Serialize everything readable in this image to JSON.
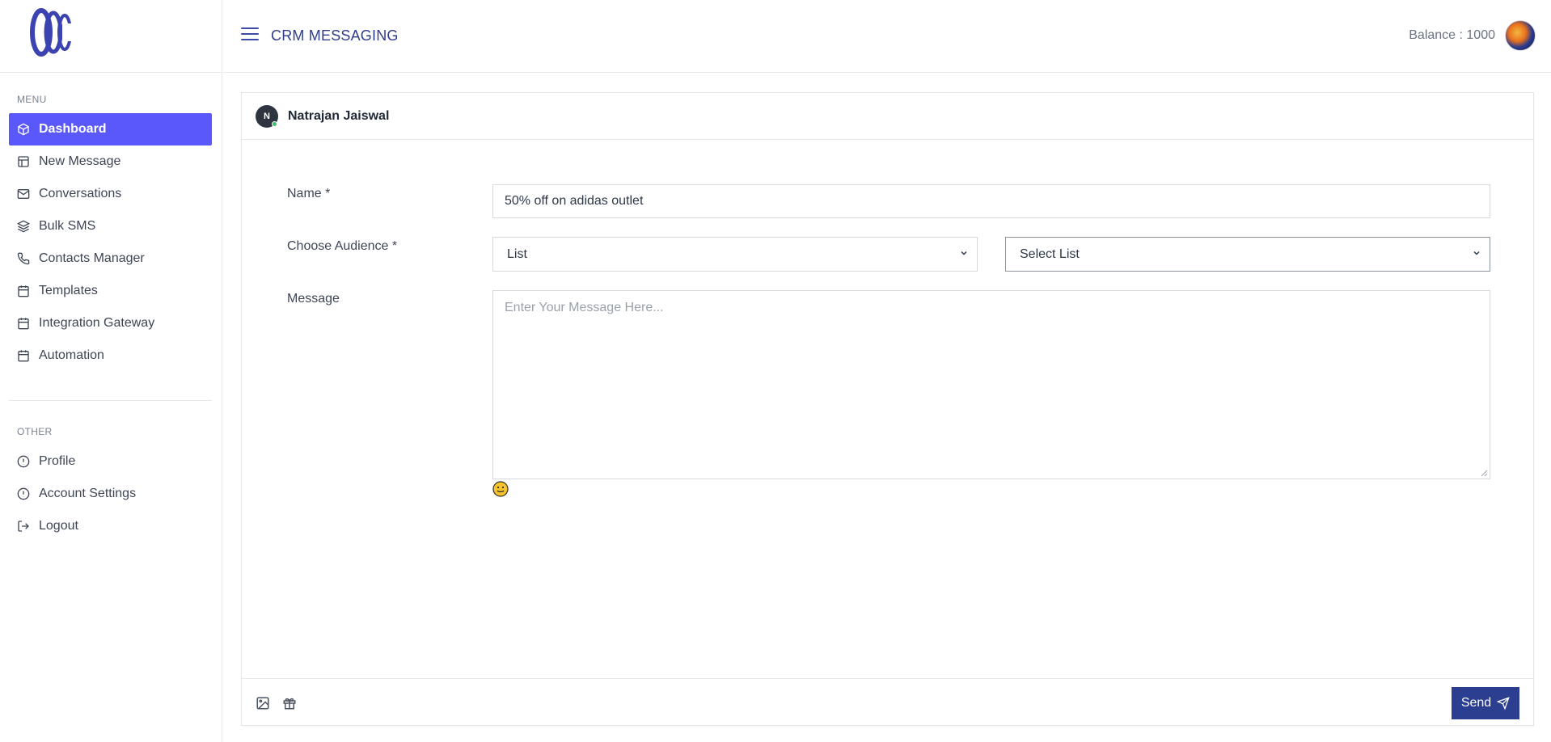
{
  "header": {
    "app_title": "CRM MESSAGING",
    "balance": "Balance : 1000"
  },
  "sidebar": {
    "menu_title": "MENU",
    "other_title": "OTHER",
    "menu_items": [
      {
        "label": "Dashboard",
        "icon": "cube-icon",
        "active": true
      },
      {
        "label": "New Message",
        "icon": "layout-icon"
      },
      {
        "label": "Conversations",
        "icon": "mail-icon"
      },
      {
        "label": "Bulk SMS",
        "icon": "layers-icon"
      },
      {
        "label": "Contacts Manager",
        "icon": "phone-icon"
      },
      {
        "label": "Templates",
        "icon": "calendar-icon"
      },
      {
        "label": "Integration Gateway",
        "icon": "calendar-icon"
      },
      {
        "label": "Automation",
        "icon": "calendar-icon"
      }
    ],
    "other_items": [
      {
        "label": "Profile",
        "icon": "alert-circle-icon"
      },
      {
        "label": "Account Settings",
        "icon": "alert-circle-icon"
      },
      {
        "label": "Logout",
        "icon": "logout-icon"
      }
    ]
  },
  "contact": {
    "initial": "N",
    "name": "Natrajan Jaiswal"
  },
  "form": {
    "name_label": "Name *",
    "name_value": "50% off on adidas outlet",
    "audience_label": "Choose Audience *",
    "audience_type": "List",
    "audience_list": "Select List",
    "message_label": "Message",
    "message_placeholder": "Enter Your Message Here..."
  },
  "footer": {
    "send_label": "Send"
  },
  "colors": {
    "accent": "#5a57fb",
    "brand": "#2c3e8f"
  }
}
